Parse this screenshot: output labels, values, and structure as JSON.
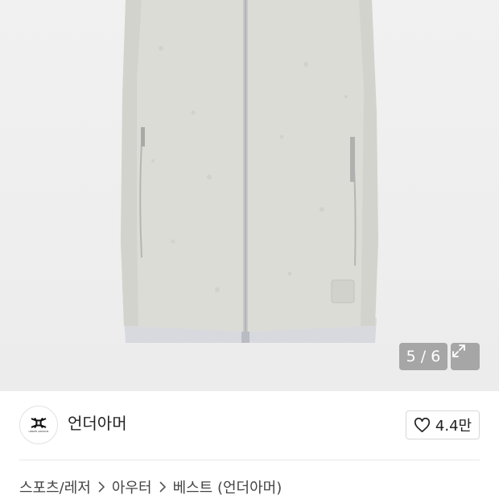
{
  "gallery": {
    "image_icon": "fleece-vest-photo",
    "counter": "5 / 6",
    "expand_icon": "expand-icon"
  },
  "brand": {
    "logo_icon": "under-armour-logo",
    "logo_text": "UNDER ARMOUR",
    "name": "언더아머",
    "like_icon": "heart-icon",
    "like_count": "4.4만"
  },
  "breadcrumb": {
    "items": [
      "스포츠/레저",
      "아우터",
      "베스트 (언더아머)"
    ],
    "separator_icon": "chevron-right-icon"
  }
}
